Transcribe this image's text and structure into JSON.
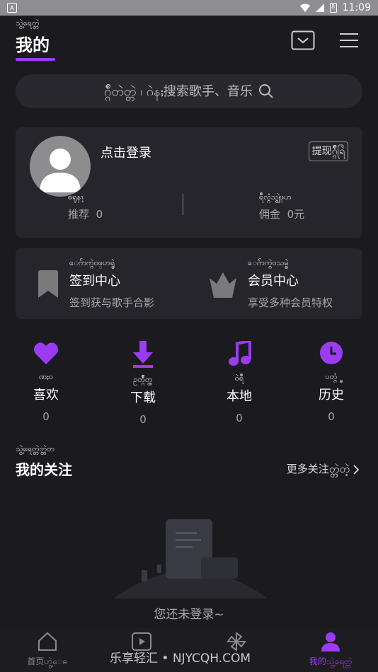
{
  "status_bar": {
    "time": "11:09",
    "battery": "8"
  },
  "header": {
    "small_label": "သွဲ့ရေတ္တဲ",
    "title": "我的"
  },
  "search": {
    "placeholder": "ဂ္ဂ်ဳတဲတ္တဲ ၊ ဂဲနႈ搜索歌手、音乐"
  },
  "profile": {
    "login_label": "点击登录",
    "withdraw_label": "提现ဂ္ဂ်ဳရြဲ",
    "recommend": {
      "small": "ဓရုနၫ့",
      "label": "推荐",
      "value": "0"
    },
    "commission": {
      "small": "ရဳလ္ဂံသျွဲဖ္ဟ",
      "label": "佣金",
      "value": "0元"
    }
  },
  "features": [
    {
      "small": "ေဂ်ာက္ဂဲဝဖ္ဟရ္ဓဲ",
      "title": "签到中心",
      "sub": "签到获与歌手合影"
    },
    {
      "small": "ေဂ်ာက္ဂဲဝသမ္ဓဲ",
      "title": "会员中心",
      "sub": "享受多种会员特权"
    }
  ],
  "quick_actions": [
    {
      "small": "ဏႈဝ",
      "label": "喜欢",
      "count": "0"
    },
    {
      "small": "ဥတ္ဂ္ဂ်ဳတ္ဂ",
      "label": "下载",
      "count": "0"
    },
    {
      "small": "ဝဲရဳ",
      "label": "本地",
      "count": "0"
    },
    {
      "small": "ပတ္ဂ္ဓံ",
      "label": "历史",
      "count": "0"
    }
  ],
  "following": {
    "small": "သွဲ့ရေတ္တဲတ္တဲတ",
    "title": "我的关注",
    "more": "更多关注တ္တဲတဲ့"
  },
  "empty_text": "您还未登录~",
  "tabs": [
    {
      "label": "首页ဟွဲ့ေဓ"
    },
    {
      "label": "视频"
    },
    {
      "label": "发现"
    },
    {
      "label": "我的သွဲ့ရေတ္တဲ"
    }
  ],
  "watermark": "乐享轻汇 • NJYCQH.COM",
  "colors": {
    "accent": "#9b3cf4",
    "background": "#1b1a1f",
    "card": "#26252b"
  }
}
